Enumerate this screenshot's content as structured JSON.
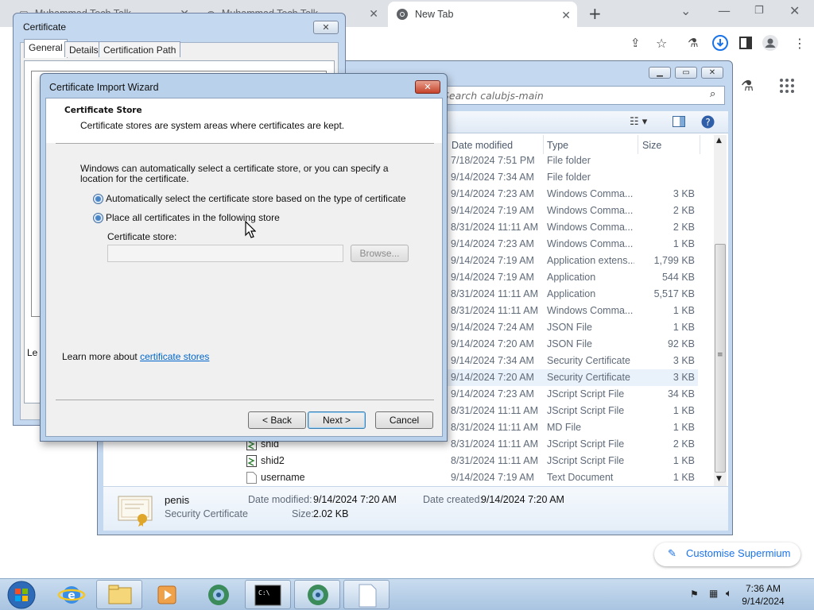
{
  "browser": {
    "tabs": [
      {
        "title": "Muhammad Tech Talk"
      },
      {
        "title": "Muhammad Tech Talk"
      },
      {
        "title": "New Tab"
      }
    ]
  },
  "explorer": {
    "search_placeholder": "Search calubjs-main",
    "columns": {
      "date": "Date modified",
      "type": "Type",
      "size": "Size"
    },
    "files": [
      {
        "name": "",
        "date": "7/18/2024 7:51 PM",
        "type": "File folder",
        "size": ""
      },
      {
        "name": "",
        "date": "9/14/2024 7:34 AM",
        "type": "File folder",
        "size": ""
      },
      {
        "name": "",
        "date": "9/14/2024 7:23 AM",
        "type": "Windows Comma...",
        "size": "3 KB"
      },
      {
        "name": "",
        "date": "9/14/2024 7:19 AM",
        "type": "Windows Comma...",
        "size": "2 KB"
      },
      {
        "name": "",
        "date": "8/31/2024 11:11 AM",
        "type": "Windows Comma...",
        "size": "2 KB"
      },
      {
        "name": "",
        "date": "9/14/2024 7:23 AM",
        "type": "Windows Comma...",
        "size": "1 KB"
      },
      {
        "name": "",
        "date": "9/14/2024 7:19 AM",
        "type": "Application extens...",
        "size": "1,799 KB"
      },
      {
        "name": "",
        "date": "9/14/2024 7:19 AM",
        "type": "Application",
        "size": "544 KB"
      },
      {
        "name": "",
        "date": "8/31/2024 11:11 AM",
        "type": "Application",
        "size": "5,517 KB"
      },
      {
        "name": "",
        "date": "8/31/2024 11:11 AM",
        "type": "Windows Comma...",
        "size": "1 KB"
      },
      {
        "name": "",
        "date": "9/14/2024 7:24 AM",
        "type": "JSON File",
        "size": "1 KB"
      },
      {
        "name": "",
        "date": "9/14/2024 7:20 AM",
        "type": "JSON File",
        "size": "92 KB"
      },
      {
        "name": "",
        "date": "9/14/2024 7:34 AM",
        "type": "Security Certificate",
        "size": "3 KB"
      },
      {
        "name": "",
        "date": "9/14/2024 7:20 AM",
        "type": "Security Certificate",
        "size": "3 KB"
      },
      {
        "name": "",
        "date": "9/14/2024 7:23 AM",
        "type": "JScript Script File",
        "size": "34 KB"
      },
      {
        "name": "",
        "date": "8/31/2024 11:11 AM",
        "type": "JScript Script File",
        "size": "1 KB"
      },
      {
        "name": "",
        "date": "8/31/2024 11:11 AM",
        "type": "MD File",
        "size": "1 KB"
      },
      {
        "name": "shid",
        "date": "8/31/2024 11:11 AM",
        "type": "JScript Script File",
        "size": "2 KB"
      },
      {
        "name": "shid2",
        "date": "8/31/2024 11:11 AM",
        "type": "JScript Script File",
        "size": "1 KB"
      },
      {
        "name": "username",
        "date": "9/14/2024 7:19 AM",
        "type": "Text Document",
        "size": "1 KB"
      }
    ],
    "details": {
      "name": "penis",
      "kind": "Security Certificate",
      "modified_label": "Date modified:",
      "modified": "9/14/2024 7:20 AM",
      "created_label": "Date created:",
      "created": "9/14/2024 7:20 AM",
      "size_label": "Size:",
      "size": "2.02 KB"
    }
  },
  "cert_dialog": {
    "title": "Certificate",
    "tabs": [
      "General",
      "Details",
      "Certification Path"
    ],
    "left_text": "Le"
  },
  "wizard": {
    "title": "Certificate Import Wizard",
    "header_title": "Certificate Store",
    "header_desc": "Certificate stores are system areas where certificates are kept.",
    "intro": "Windows can automatically select a certificate store, or you can specify a location for the certificate.",
    "radio_auto": "Automatically select the certificate store based on the type of certificate",
    "radio_place": "Place all certificates in the following store",
    "store_label": "Certificate store:",
    "store_value": "",
    "browse_label": "Browse...",
    "learn_prefix": "Learn more about ",
    "learn_link": "certificate stores",
    "back_label": "< Back",
    "next_label": "Next >",
    "cancel_label": "Cancel"
  },
  "customise_label": "Customise Supermium",
  "clock": {
    "time": "7:36 AM",
    "date": "9/14/2024"
  },
  "colors": {
    "link": "#0066cc",
    "accent": "#1a73e8"
  }
}
